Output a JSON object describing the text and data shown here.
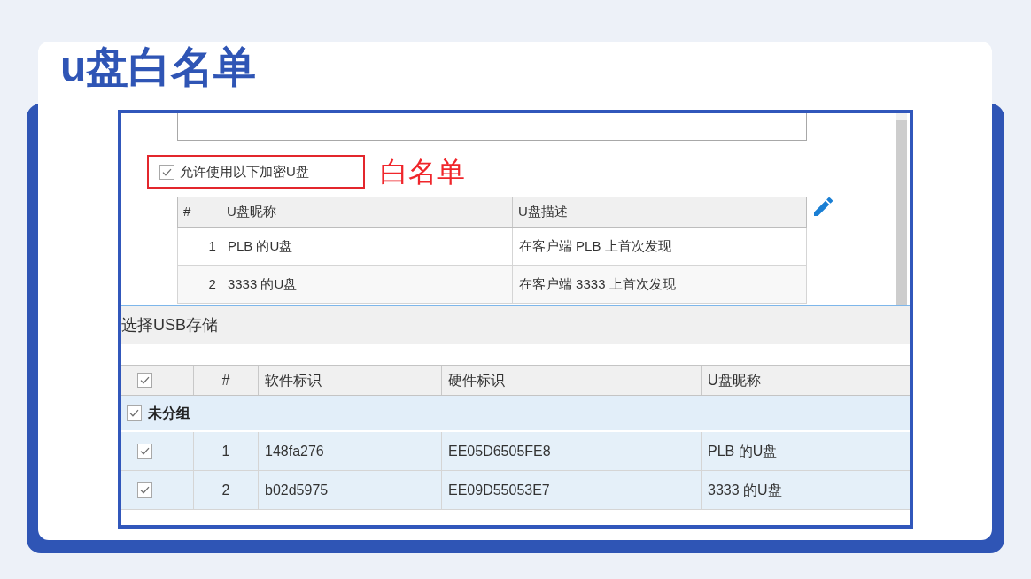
{
  "page_title": "u盘白名单",
  "screenshot": {
    "whitelist_option": {
      "label": "允许使用以下加密U盘",
      "checked": true
    },
    "annotation": "白名单",
    "whitelist_table": {
      "columns": [
        "#",
        "U盘昵称",
        "U盘描述"
      ],
      "rows": [
        [
          "1",
          "PLB 的U盘",
          "在客户端 PLB 上首次发现"
        ],
        [
          "2",
          "3333 的U盘",
          "在客户端 3333 上首次发现"
        ]
      ]
    },
    "usb_dialog": {
      "title": "选择USB存储",
      "table": {
        "header_checked": true,
        "columns": [
          "#",
          "软件标识",
          "硬件标识",
          "U盘昵称"
        ],
        "groups": [
          {
            "label": "未分组",
            "checked": true,
            "rows": [
              {
                "checked": true,
                "cells": [
                  "1",
                  "148fa276",
                  "EE05D6505FE8",
                  "PLB 的U盘"
                ]
              },
              {
                "checked": true,
                "cells": [
                  "2",
                  "b02d5975",
                  "EE09D55053E7",
                  "3333 的U盘"
                ]
              }
            ]
          }
        ]
      }
    }
  }
}
